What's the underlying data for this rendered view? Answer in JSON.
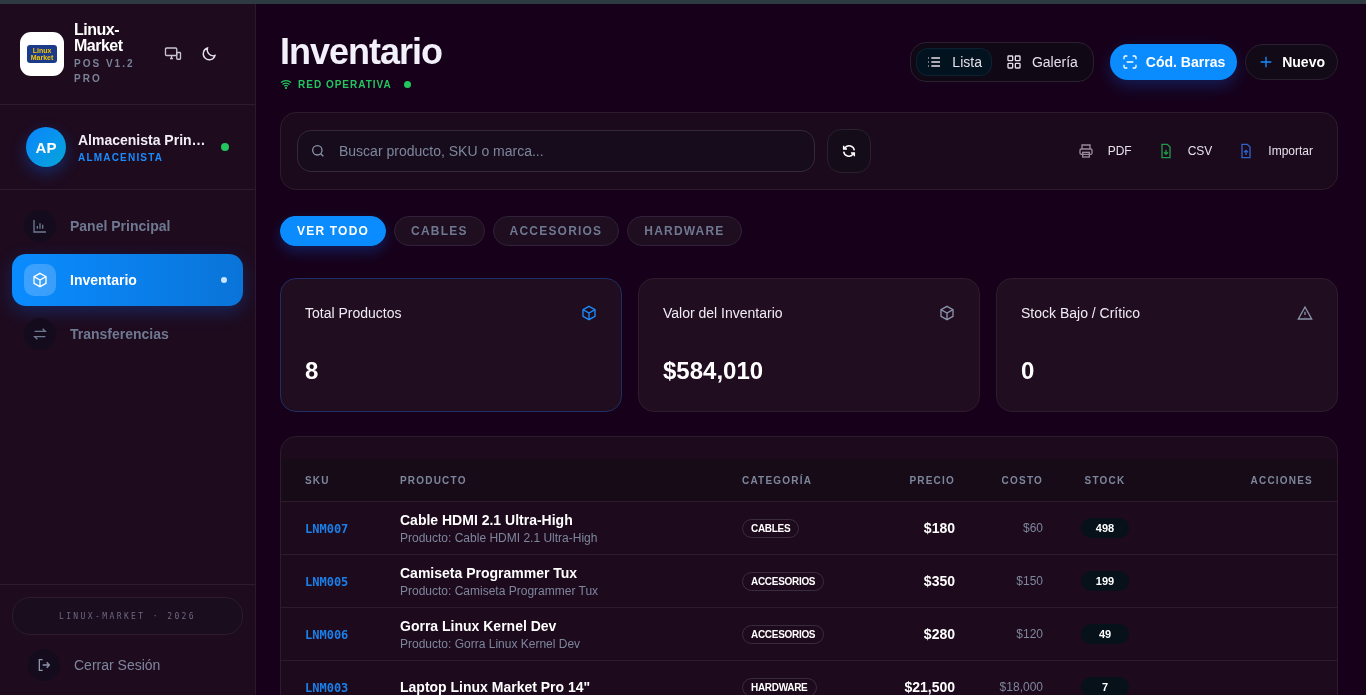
{
  "sidebar": {
    "brand": {
      "name": "Linux-Market",
      "logo_text": "Linux Market",
      "version": "POS V1.2 PRO"
    },
    "user": {
      "initials": "AP",
      "name": "Almacenista Prin…",
      "role": "ALMACENISTA",
      "online": true
    },
    "nav": [
      {
        "label": "Panel Principal",
        "selected": false
      },
      {
        "label": "Inventario",
        "selected": true
      },
      {
        "label": "Transferencias",
        "selected": false
      }
    ],
    "footer": "LINUX-MARKET · 2026",
    "logout": "Cerrar Sesión"
  },
  "header": {
    "title": "Inventario",
    "status": "RED OPERATIVA",
    "online": true,
    "views": [
      {
        "label": "Lista",
        "selected": true
      },
      {
        "label": "Galería",
        "selected": false
      }
    ],
    "barcode_button": "Cód. Barras",
    "new_button": "Nuevo"
  },
  "toolbar": {
    "search": {
      "placeholder": "Buscar producto, SKU o marca..."
    },
    "exports": [
      {
        "label": "PDF",
        "kind": "print"
      },
      {
        "label": "CSV",
        "kind": "download"
      },
      {
        "label": "Importar",
        "kind": "upload"
      }
    ]
  },
  "filters": [
    {
      "label": "VER TODO",
      "selected": true
    },
    {
      "label": "CABLES",
      "selected": false
    },
    {
      "label": "ACCESORIOS",
      "selected": false
    },
    {
      "label": "HARDWARE",
      "selected": false
    }
  ],
  "stats": [
    {
      "label": "Total Productos",
      "value": "8",
      "highlighted": true
    },
    {
      "label": "Valor del Inventario",
      "value": "$584,010",
      "highlighted": false
    },
    {
      "label": "Stock Bajo / Crítico",
      "value": "0",
      "highlighted": false
    }
  ],
  "table": {
    "columns": [
      "SKU",
      "PRODUCTO",
      "CATEGORÍA",
      "PRECIO",
      "COSTO",
      "STOCK",
      "ACCIONES"
    ],
    "rows": [
      {
        "sku": "LNM007",
        "name": "Cable HDMI 2.1 Ultra-High",
        "subtitle": "Producto: Cable HDMI 2.1 Ultra-High",
        "category": "CABLES",
        "price": "$180",
        "cost": "$60",
        "stock": "498"
      },
      {
        "sku": "LNM005",
        "name": "Camiseta Programmer Tux",
        "subtitle": "Producto: Camiseta Programmer Tux",
        "category": "ACCESORIOS",
        "price": "$350",
        "cost": "$150",
        "stock": "199"
      },
      {
        "sku": "LNM006",
        "name": "Gorra Linux Kernel Dev",
        "subtitle": "Producto: Gorra Linux Kernel Dev",
        "category": "ACCESORIOS",
        "price": "$280",
        "cost": "$120",
        "stock": "49"
      },
      {
        "sku": "LNM003",
        "name": "Laptop Linux Market Pro 14\"",
        "category": "HARDWARE",
        "price": "$21,500",
        "cost": "$18,000",
        "stock": "7"
      }
    ]
  }
}
